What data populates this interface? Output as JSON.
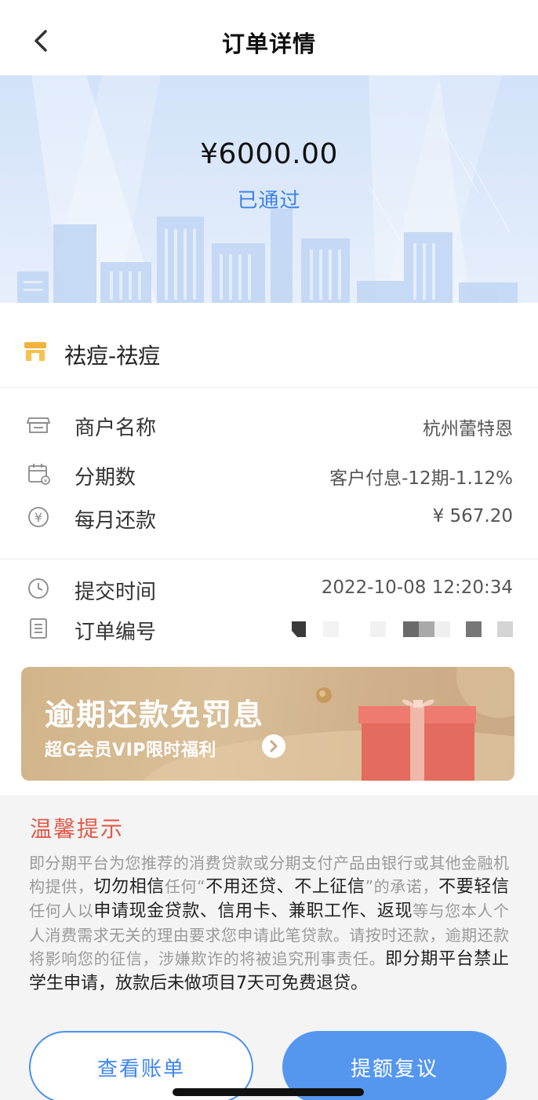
{
  "nav": {
    "title": "订单详情",
    "back_icon": "chevron-left-icon"
  },
  "summary": {
    "amount": "¥6000.00",
    "status": "已通过",
    "status_color": "#3a82e6"
  },
  "product": {
    "icon": "store-icon",
    "name": "祛痘-祛痘"
  },
  "details": [
    {
      "icon": "merchant-icon",
      "label": "商户名称",
      "value": "杭州蕾特恩"
    },
    {
      "icon": "calendar-icon",
      "label": "分期数",
      "value": "客户付息-12期-1.12%"
    },
    {
      "icon": "yuan-icon",
      "label": "每月还款",
      "value": "¥ 567.20"
    }
  ],
  "order_meta": [
    {
      "icon": "clock-icon",
      "label": "提交时间",
      "value": "2022-10-08 12:20:34"
    },
    {
      "icon": "document-icon",
      "label": "订单编号"
    }
  ],
  "promo": {
    "title": "逾期还款免罚息",
    "subtitle": "超G会员VIP限时福利",
    "arrow_icon": "chevron-right-circle-icon",
    "gift_icon": "gift-box-icon",
    "background": "#d4b68e"
  },
  "tips": {
    "title": "温馨提示",
    "p1": "即分期平台为您推荐的消费贷款或分期支付产品由银行或其他金融机构提供，",
    "h1": "切勿相信",
    "p2": "任何“",
    "h2": "不用还贷、不上征信",
    "p3": "”的承诺，",
    "h3": "不要轻信",
    "p4": "任何人以",
    "h4": "申请现金贷款、信用卡、兼职工作、返现",
    "p5": "等与您本人个人消费需求无关的理由要求您申请此笔贷款。请按时还款，逾期还款将影响您的征信，涉嫌欺诈的将被追究刑事责任。",
    "h5": "即分期平台禁止学生申请，放款后未做项目7天可免费退贷。"
  },
  "actions": {
    "view_bill": "查看账单",
    "limit_review": "提额复议"
  },
  "colors": {
    "primary": "#4a8ff0",
    "warning_title": "#e05a4a"
  }
}
